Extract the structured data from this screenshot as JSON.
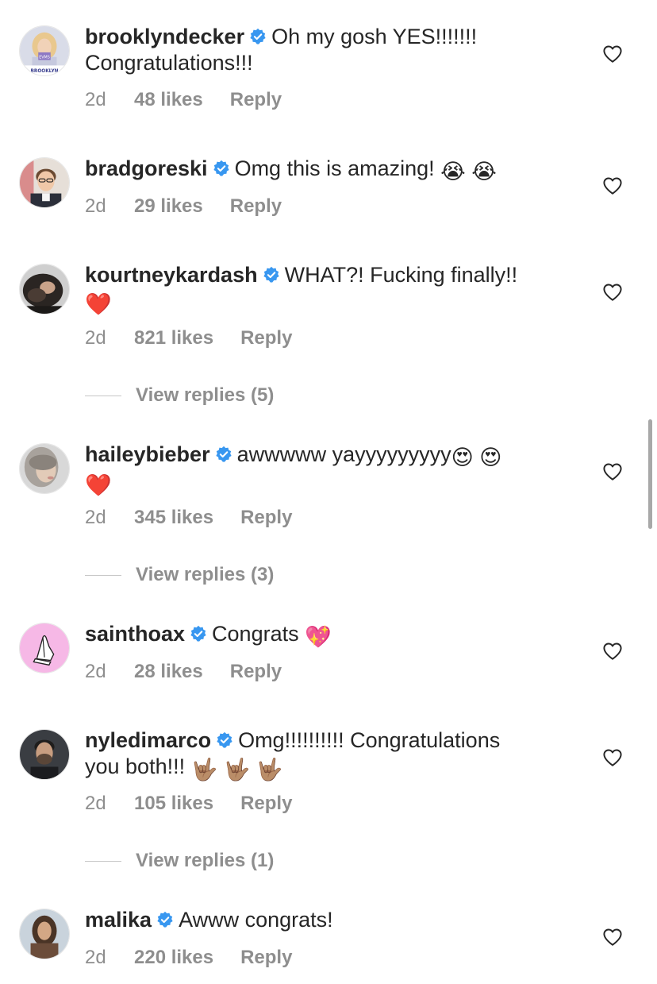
{
  "comments": [
    {
      "username": "brooklyndecker",
      "text_line1": "Oh my gosh YES!!!!!!!",
      "text_line2": "Congratulations!!!",
      "emoji": "",
      "time": "2d",
      "likes": "48 likes",
      "reply": "Reply",
      "avatar_caption": "BROOKLYN",
      "avatar_small_text": "EVMS"
    },
    {
      "username": "bradgoreski",
      "text_line1": "Omg this is amazing!",
      "emoji": "😭 😭",
      "time": "2d",
      "likes": "29 likes",
      "reply": "Reply"
    },
    {
      "username": "kourtneykardash",
      "text_line1": "WHAT?! Fucking finally!!",
      "emoji": "❤️",
      "time": "2d",
      "likes": "821 likes",
      "reply": "Reply",
      "view_replies": "View replies (5)"
    },
    {
      "username": "haileybieber",
      "text_line1": "awwwww yayyyyyyyyy",
      "emoji_inline": "😍 😍",
      "emoji": "❤️",
      "time": "2d",
      "likes": "345 likes",
      "reply": "Reply",
      "view_replies": "View replies (3)"
    },
    {
      "username": "sainthoax",
      "text_line1": "Congrats",
      "emoji": "💖",
      "time": "2d",
      "likes": "28 likes",
      "reply": "Reply"
    },
    {
      "username": "nyledimarco",
      "text_line1": "Omg!!!!!!!!!! Congratulations",
      "text_line2": "you both!!!",
      "emoji": "🤟🏽 🤟🏽 🤟🏽",
      "time": "2d",
      "likes": "105 likes",
      "reply": "Reply",
      "view_replies": "View replies (1)"
    },
    {
      "username": "malika",
      "text_line1": "Awww congrats!",
      "time": "2d",
      "likes": "220 likes",
      "reply": "Reply"
    }
  ],
  "icons": {
    "verified": "verified-badge-icon",
    "like": "heart-outline-icon"
  },
  "colors": {
    "text": "#262626",
    "secondary": "#8e8e8e",
    "verified_blue": "#3897f0",
    "divider": "#c7c7c7"
  }
}
